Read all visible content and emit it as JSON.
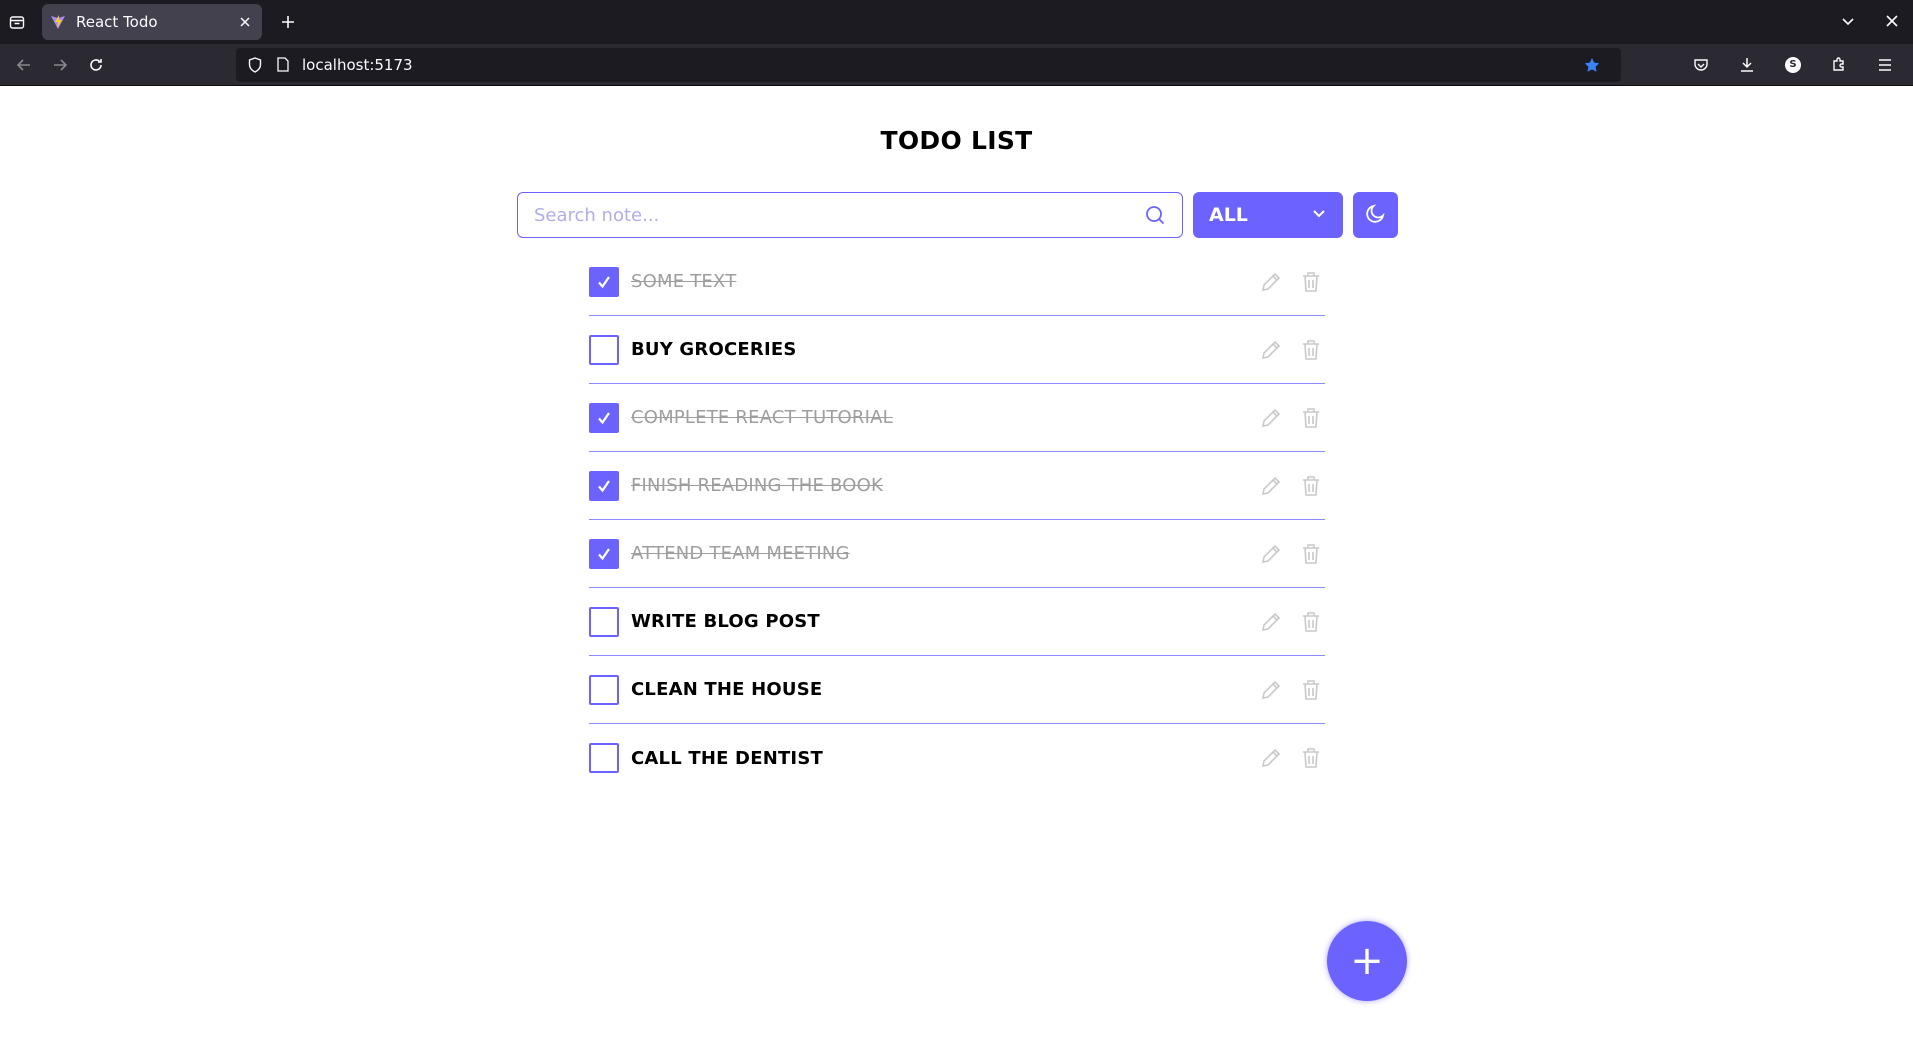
{
  "browser": {
    "tab_title": "React Todo",
    "url": "localhost:5173"
  },
  "page": {
    "title": "TODO LIST",
    "search_placeholder": "Search note...",
    "filter_value": "ALL",
    "accent_color": "#6c63ff"
  },
  "todos": [
    {
      "text": "SOME TEXT",
      "done": true
    },
    {
      "text": "BUY GROCERIES",
      "done": false
    },
    {
      "text": "COMPLETE REACT TUTORIAL",
      "done": true
    },
    {
      "text": "FINISH READING THE BOOK",
      "done": true
    },
    {
      "text": "ATTEND TEAM MEETING",
      "done": true
    },
    {
      "text": "WRITE BLOG POST",
      "done": false
    },
    {
      "text": "CLEAN THE HOUSE",
      "done": false
    },
    {
      "text": "CALL THE DENTIST",
      "done": false
    }
  ],
  "fab_label": "+"
}
